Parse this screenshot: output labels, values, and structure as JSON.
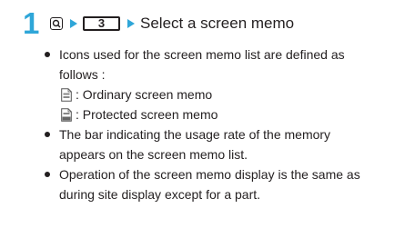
{
  "step": {
    "number": "1",
    "key_3_label": "3",
    "text": "Select a screen memo"
  },
  "notes": {
    "item1": {
      "text_line1": "Icons used for the screen memo list are defined as",
      "text_line2": "follows :",
      "icons": [
        {
          "icon": "ordinary-screen-memo-icon",
          "text": ": Ordinary screen memo"
        },
        {
          "icon": "protected-screen-memo-icon",
          "text": ": Protected screen memo"
        }
      ]
    },
    "item2": {
      "text_line1": "The bar indicating the usage rate of the memory",
      "text_line2": "appears on the screen memo list."
    },
    "item3": {
      "text_line1": "Operation of the screen memo display is the same as",
      "text_line2": "during site display except for a part."
    }
  },
  "colors": {
    "accent": "#2fa6d8",
    "text": "#231f20"
  }
}
